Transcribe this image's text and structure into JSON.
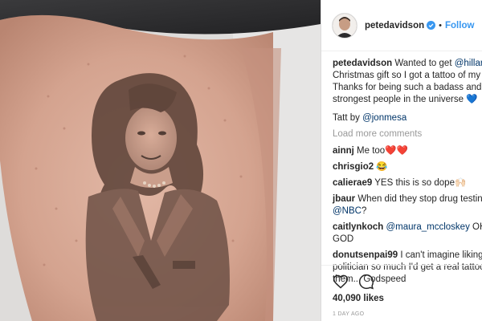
{
  "post": {
    "username": "petedavidson",
    "follow_label": "Follow",
    "dot": "•",
    "icons": {
      "verified": "verified-badge-icon",
      "like": "heart-icon",
      "comment": "comment-bubble-icon"
    }
  },
  "caption": {
    "handle": "petedavidson",
    "part1": " Wanted to get ",
    "mention": "@hillaryclinton",
    "part2": " a Christmas gift so I got a tattoo of my hero. Thanks for being such a badass and one of the strongest people in the universe ",
    "emoji": "💙",
    "tatt_by": "Tatt by ",
    "tatt_mention": "@jonmesa"
  },
  "load_more": "Load more comments",
  "comments": [
    {
      "handle": "ainnj",
      "text": " Me too❤️❤️"
    },
    {
      "handle": "chrisgio2",
      "text": " 😂"
    },
    {
      "handle": "calierae9",
      "text": " YES this is so dope🙌🏻"
    },
    {
      "handle": "jbaur",
      "text": " When did they stop drug testing at ",
      "mention": "@NBC",
      "after": "?"
    },
    {
      "handle": "caitlynkoch",
      "mention": " @maura_mccloskey",
      "text": " OH MY GOD"
    },
    {
      "handle": "donutsenpai99",
      "text": " I can't imagine liking a politician so much I'd get a real tattoo of them... Godspeed"
    }
  ],
  "likes": "40,090 likes",
  "timestamp": "1 DAY AGO",
  "colors": {
    "link": "#003569",
    "follow": "#3897f0",
    "muted": "#999999",
    "emoji_heart": "#3b8fe0"
  }
}
